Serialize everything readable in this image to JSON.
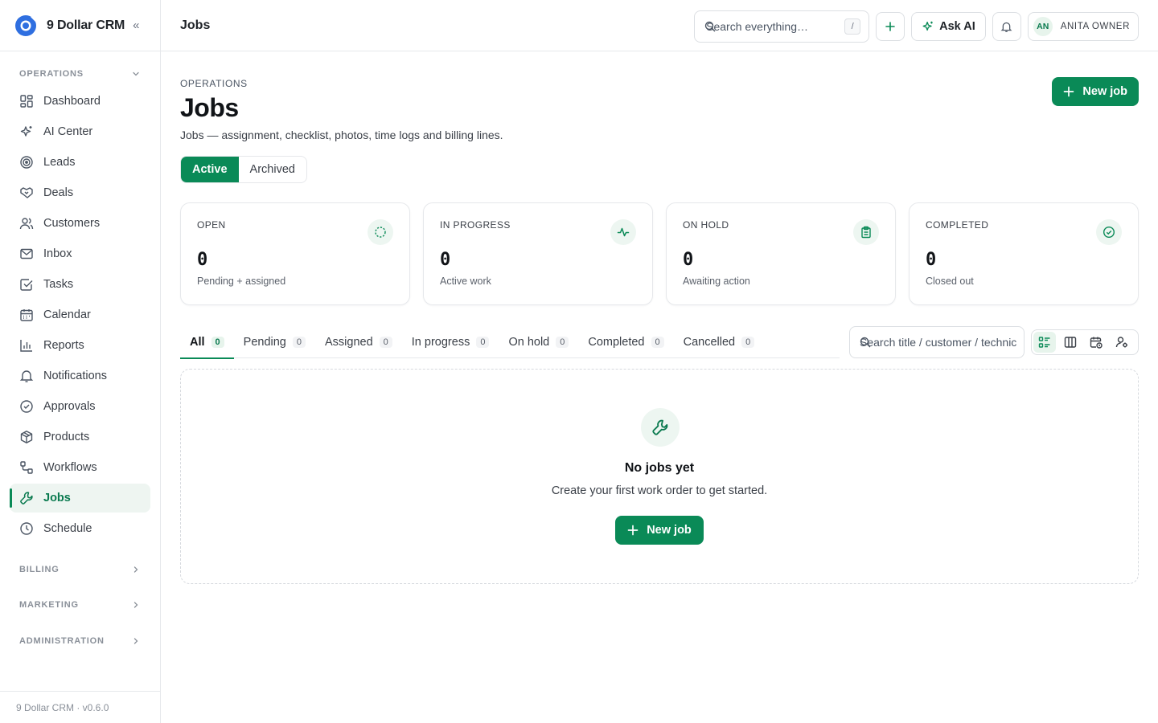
{
  "app": {
    "name": "9 Dollar CRM",
    "version_footer": "9 Dollar CRM · v0.6.0"
  },
  "topbar": {
    "title": "Jobs",
    "search_placeholder": "Search everything…",
    "search_shortcut": "/",
    "ask_ai_label": "Ask AI",
    "user_initials": "AN",
    "user_name": "ANITA OWNER"
  },
  "sidebar": {
    "sections": {
      "operations": "OPERATIONS",
      "billing": "BILLING",
      "marketing": "MARKETING",
      "administration": "ADMINISTRATION"
    },
    "items": [
      {
        "label": "Dashboard",
        "icon": "dashboard-icon"
      },
      {
        "label": "AI Center",
        "icon": "sparkle-icon"
      },
      {
        "label": "Leads",
        "icon": "target-icon"
      },
      {
        "label": "Deals",
        "icon": "handshake-icon"
      },
      {
        "label": "Customers",
        "icon": "users-icon"
      },
      {
        "label": "Inbox",
        "icon": "mail-icon"
      },
      {
        "label": "Tasks",
        "icon": "checkbox-icon"
      },
      {
        "label": "Calendar",
        "icon": "calendar-icon"
      },
      {
        "label": "Reports",
        "icon": "bar-chart-icon"
      },
      {
        "label": "Notifications",
        "icon": "bell-icon"
      },
      {
        "label": "Approvals",
        "icon": "check-circle-icon"
      },
      {
        "label": "Products",
        "icon": "box-icon"
      },
      {
        "label": "Workflows",
        "icon": "workflow-icon"
      },
      {
        "label": "Jobs",
        "icon": "wrench-icon",
        "active": true
      },
      {
        "label": "Schedule",
        "icon": "clock-icon"
      }
    ]
  },
  "page": {
    "eyebrow": "OPERATIONS",
    "title": "Jobs",
    "description": "Jobs — assignment, checklist, photos, time logs and billing lines.",
    "new_job_label": "New job",
    "segments": [
      "Active",
      "Archived"
    ],
    "active_segment": "Active"
  },
  "stats": [
    {
      "label": "OPEN",
      "value": "0",
      "sub": "Pending + assigned",
      "icon": "loader-circle-icon"
    },
    {
      "label": "IN PROGRESS",
      "value": "0",
      "sub": "Active work",
      "icon": "activity-icon"
    },
    {
      "label": "ON HOLD",
      "value": "0",
      "sub": "Awaiting action",
      "icon": "clipboard-icon"
    },
    {
      "label": "COMPLETED",
      "value": "0",
      "sub": "Closed out",
      "icon": "check-circle-icon"
    }
  ],
  "tabs": [
    {
      "label": "All",
      "count": "0",
      "active": true
    },
    {
      "label": "Pending",
      "count": "0"
    },
    {
      "label": "Assigned",
      "count": "0"
    },
    {
      "label": "In progress",
      "count": "0"
    },
    {
      "label": "On hold",
      "count": "0"
    },
    {
      "label": "Completed",
      "count": "0"
    },
    {
      "label": "Cancelled",
      "count": "0"
    }
  ],
  "list": {
    "search_placeholder": "Search title / customer / technician",
    "views": [
      "list-view-icon",
      "board-view-icon",
      "calendar-view-icon",
      "technician-view-icon"
    ],
    "active_view": "list-view-icon"
  },
  "empty_state": {
    "title": "No jobs yet",
    "description": "Create your first work order to get started.",
    "button_label": "New job"
  },
  "colors": {
    "accent": "#0a8a57",
    "accent_soft": "#edf6f1",
    "border": "#e6e8eb"
  }
}
